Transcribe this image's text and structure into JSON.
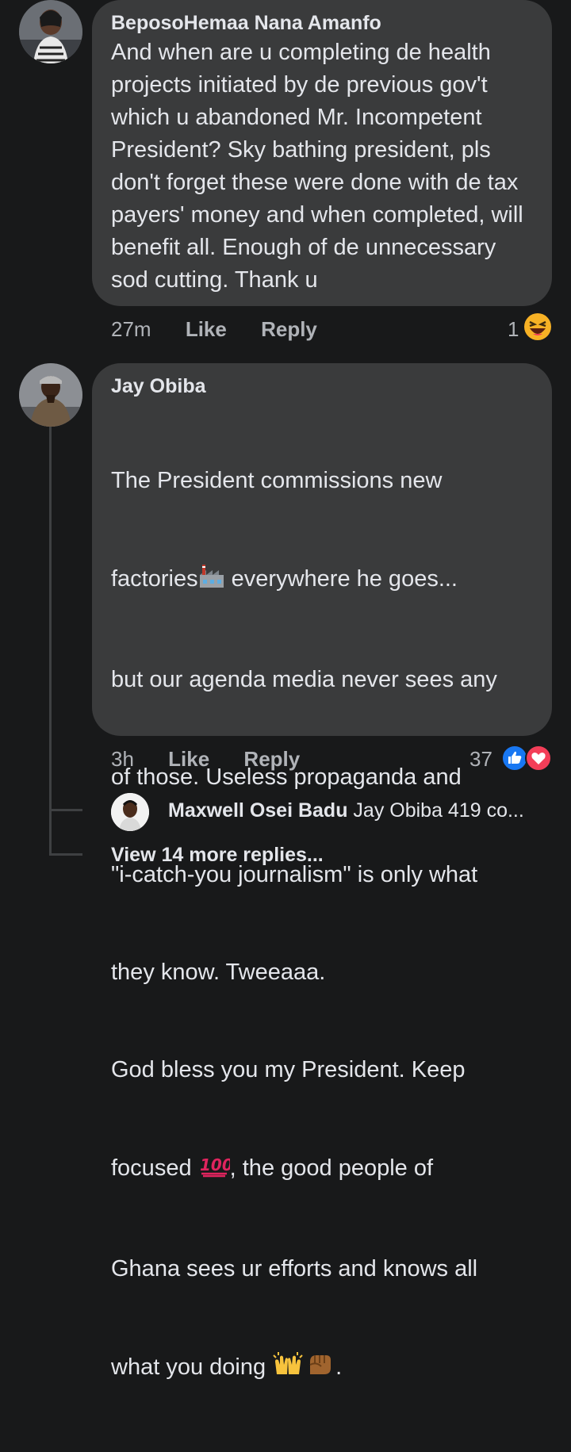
{
  "comments": [
    {
      "author": "BeposoHemaa Nana Amanfo",
      "text": "And when are u completing de health projects initiated by de previous gov't which u abandoned Mr. Incompetent President? Sky bathing president, pls don't forget these were done with de tax payers' money and when completed, will benefit all. Enough of de unnecessary sod cutting. Thank u",
      "time": "27m",
      "like_label": "Like",
      "reply_label": "Reply",
      "reaction_count": "1",
      "reactions": [
        "haha-icon"
      ]
    },
    {
      "author": "Jay Obiba",
      "text_lines": [
        "The President commissions new",
        "factories",
        " everywhere he goes...",
        "but our agenda media never sees any",
        "of those. Useless propaganda and",
        "\"i-catch-you journalism\" is only what",
        "they know. Tweeaaa.",
        "God bless you my President. Keep",
        "focused ",
        ", the good people of",
        "Ghana sees ur efforts and knows all",
        "what you doing ",
        "."
      ],
      "time": "3h",
      "like_label": "Like",
      "reply_label": "Reply",
      "reaction_count": "37",
      "reactions": [
        "like-icon",
        "love-icon"
      ]
    }
  ],
  "reply_preview": {
    "author": "Maxwell Osei Badu",
    "text": "Jay Obiba 419 co..."
  },
  "view_more": "View 14 more replies...",
  "colors": {
    "background": "#18191a",
    "bubble": "#3a3b3c",
    "text": "#e4e6eb",
    "meta": "#b0b3b8",
    "like_blue": "#1877f2",
    "love_red": "#f33e58"
  }
}
